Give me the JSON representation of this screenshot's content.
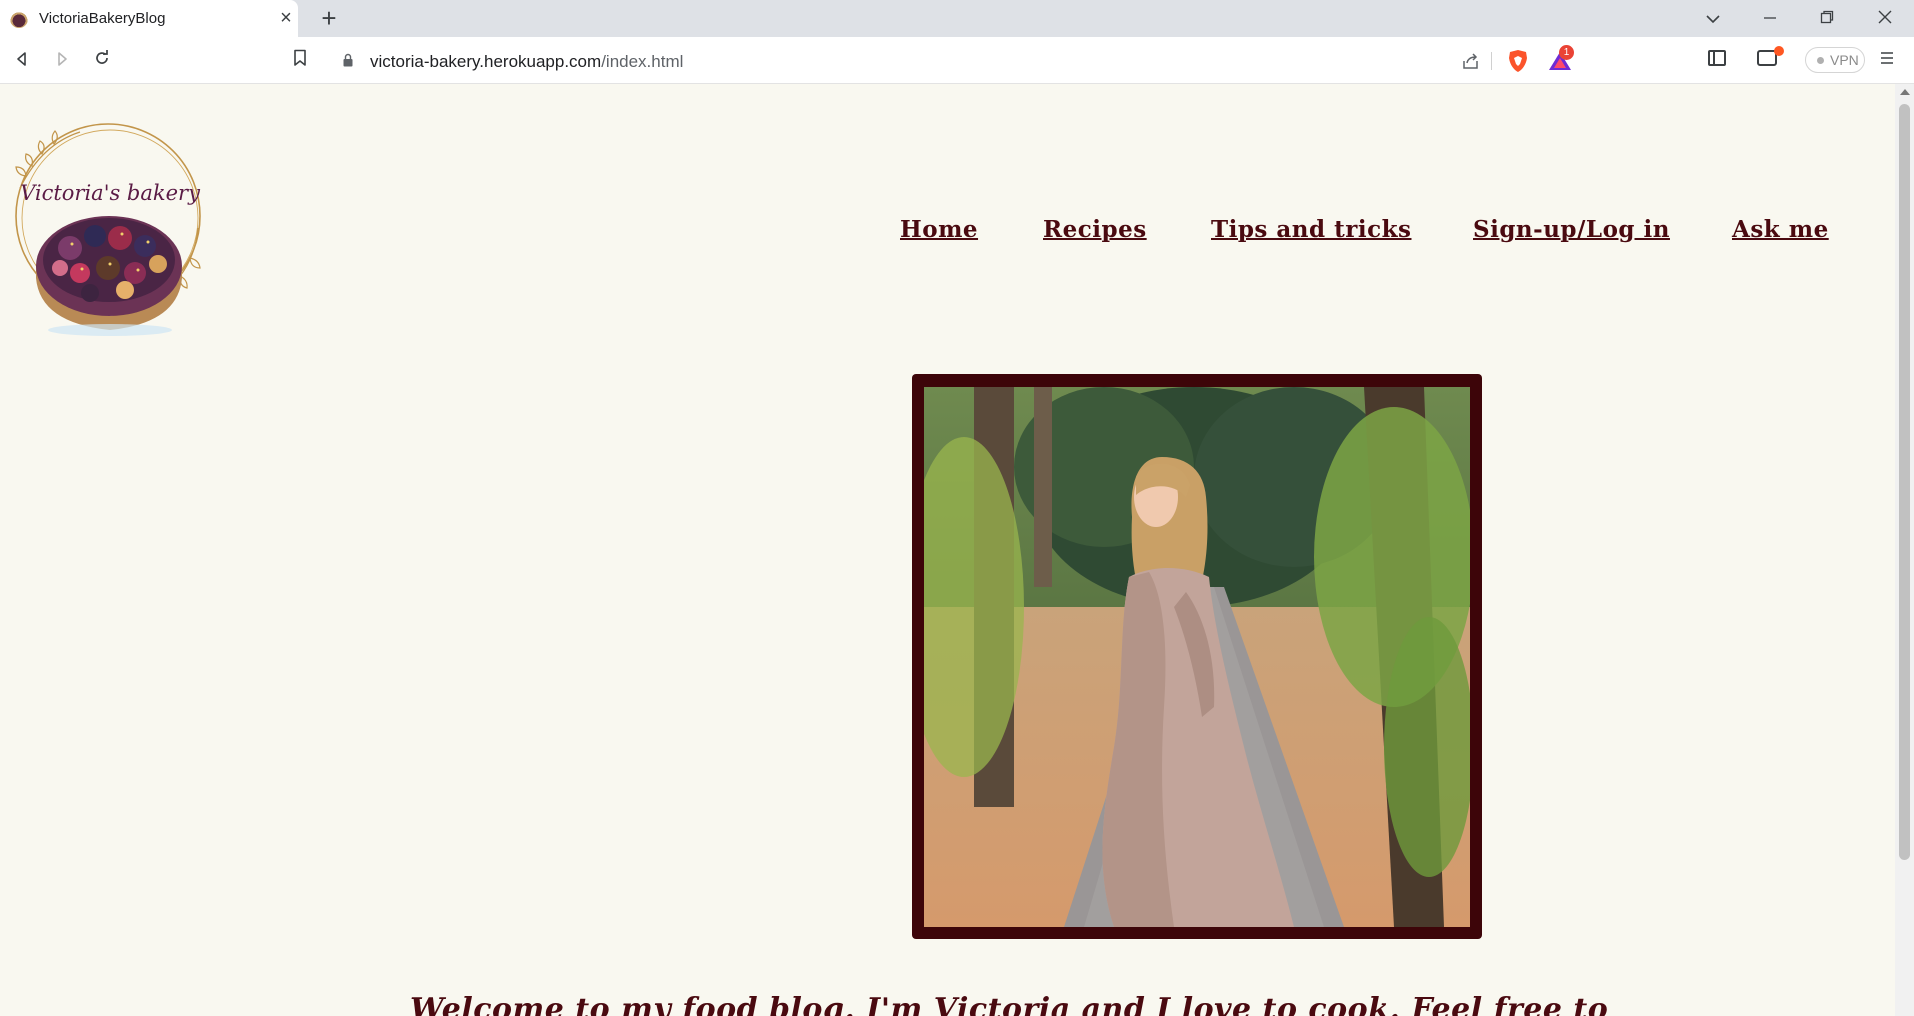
{
  "browser": {
    "tab_title": "VictoriaBakeryBlog",
    "url_host": "victoria-bakery.herokuapp.com",
    "url_path": "/index.html",
    "rewards_badge": "1",
    "vpn_label": "VPN"
  },
  "site": {
    "logo_text": "Victoria's bakery",
    "nav": [
      {
        "label": "Home"
      },
      {
        "label": "Recipes"
      },
      {
        "label": "Tips and tricks"
      },
      {
        "label": "Sign-up/Log in"
      },
      {
        "label": "Ask me"
      }
    ],
    "welcome_text": "Welcome to my food blog. I'm Victoria and I love to cook. Feel free to",
    "colors": {
      "background": "#f9f8f0",
      "accent": "#4a0a10",
      "frame": "#3d0509"
    }
  }
}
